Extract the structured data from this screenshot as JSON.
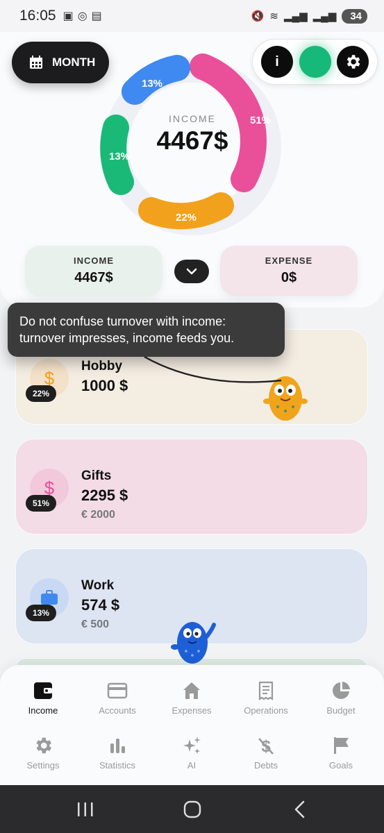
{
  "status_bar": {
    "time": "16:05",
    "battery": "34"
  },
  "header": {
    "month_label": "MONTH",
    "info_label": "i"
  },
  "donut": {
    "label": "INCOME",
    "value": "4467$",
    "segments": [
      {
        "pct": "51%",
        "color": "#ea4f9a"
      },
      {
        "pct": "22%",
        "color": "#f2a11c"
      },
      {
        "pct": "13%",
        "color": "#1bb978"
      },
      {
        "pct": "13%",
        "color": "#3f8af0"
      }
    ]
  },
  "summary": {
    "income_label": "INCOME",
    "income_value": "4467$",
    "expense_label": "EXPENSE",
    "expense_value": "0$"
  },
  "tooltip": {
    "text": "Do not confuse turnover with income: turnover impresses, income feeds you."
  },
  "categories": [
    {
      "name": "Hobby",
      "amount": "1000 $",
      "sub": "",
      "pct": "22%",
      "icon": "dollar-icon",
      "accent": "#f2a11c"
    },
    {
      "name": "Gifts",
      "amount": "2295 $",
      "sub": "€ 2000",
      "pct": "51%",
      "icon": "dollar-icon",
      "accent": "#ea4f9a"
    },
    {
      "name": "Work",
      "amount": "574 $",
      "sub": "€ 500",
      "pct": "13%",
      "icon": "briefcase-icon",
      "accent": "#3f8af0"
    }
  ],
  "nav": {
    "row1": [
      "Income",
      "Accounts",
      "Expenses",
      "Operations",
      "Budget"
    ],
    "row2": [
      "Settings",
      "Statistics",
      "AI",
      "Debts",
      "Goals"
    ]
  }
}
